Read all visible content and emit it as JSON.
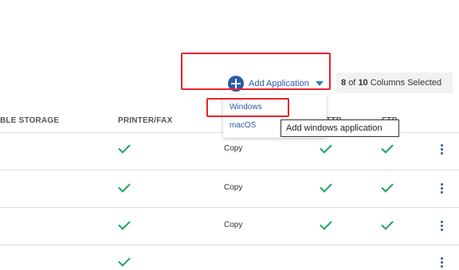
{
  "toolbar": {
    "add_application_label": "Add Application",
    "columns_selected": {
      "selected": "8",
      "of_word": "of",
      "total": "10",
      "suffix": "Columns Selected"
    }
  },
  "dropdown": {
    "items": [
      {
        "label": "Windows"
      },
      {
        "label": "macOS"
      }
    ]
  },
  "tooltip": {
    "text": "Add windows application"
  },
  "table": {
    "headers": {
      "storage": "BLE STORAGE",
      "printer_fax": "PRINTER/FAX",
      "ttp": "TTP",
      "ftp": "FTP"
    },
    "rows": [
      {
        "printer_fax": true,
        "copy": "Copy",
        "ttp": true,
        "ftp": true
      },
      {
        "printer_fax": true,
        "copy": "Copy",
        "ttp": true,
        "ftp": true
      },
      {
        "printer_fax": true,
        "copy": "Copy",
        "ttp": true,
        "ftp": true
      },
      {
        "printer_fax": true,
        "copy": "",
        "ttp": false,
        "ftp": false
      }
    ]
  },
  "colors": {
    "accent": "#2c5aa8",
    "check": "#1aa55b",
    "annotation": "#e8232a"
  }
}
